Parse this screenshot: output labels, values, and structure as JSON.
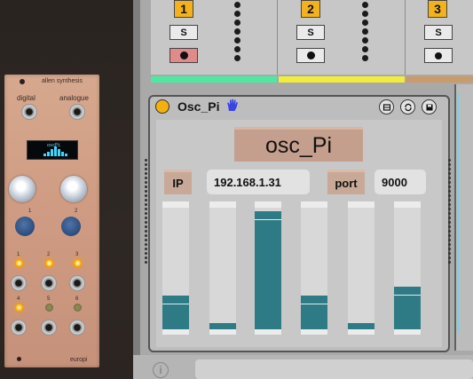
{
  "module": {
    "brand": "allen synthesis",
    "label_left": "digital",
    "label_right": "analogue",
    "screen_text": "oscPi",
    "button_labels": [
      "1",
      "2"
    ],
    "led_labels": [
      "1",
      "2",
      "3",
      "4",
      "5",
      "6"
    ],
    "footer": "europi"
  },
  "tracks": [
    {
      "number": "1",
      "solo": "S",
      "arm_active": true,
      "color": "#4ee8a0"
    },
    {
      "number": "2",
      "solo": "S",
      "arm_active": false,
      "color": "#f2ec3c"
    },
    {
      "number": "3",
      "solo": "S",
      "arm_active": false,
      "color": "#c99a6a"
    }
  ],
  "device": {
    "name": "Osc_Pi",
    "hand_icon": "hand-icon",
    "header_buttons": [
      "map-icon",
      "refresh-icon",
      "save-icon"
    ],
    "title": "osc_Pi",
    "ip_label": "IP",
    "ip_value": "192.168.1.31",
    "port_label": "port",
    "port_value": "9000",
    "sliders": [
      0.28,
      0.05,
      0.97,
      0.28,
      0.05,
      0.35
    ]
  },
  "colors": {
    "accent": "#f3b21b",
    "slider_fill": "#2f7b85",
    "title_bg": "#c59f8d"
  },
  "status": {
    "info_icon": "i"
  }
}
